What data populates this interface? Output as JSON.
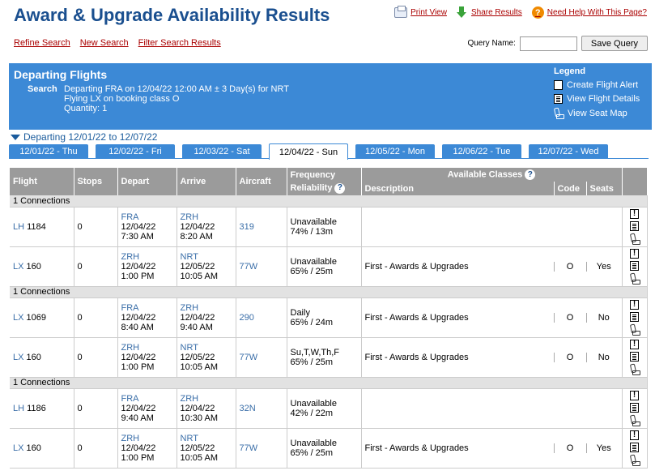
{
  "page": {
    "title": "Award & Upgrade Availability Results",
    "print_view": "Print View",
    "share_results": "Share Results",
    "need_help": "Need Help With This Page?",
    "refine_search": "Refine Search",
    "new_search": "New Search",
    "filter_results": "Filter Search Results",
    "query_name_label": "Query Name:",
    "query_name_value": "",
    "save_query": "Save Query"
  },
  "departing": {
    "header": "Departing Flights",
    "search_label": "Search",
    "search_line1": "Departing FRA on 12/04/22 12:00 AM ± 3 Day(s) for NRT",
    "search_line2": "Flying LX on booking class O",
    "search_line3": "Quantity: 1",
    "range": "Departing 12/01/22 to 12/07/22"
  },
  "legend": {
    "title": "Legend",
    "alert": "Create Flight Alert",
    "details": "View Flight Details",
    "seatmap": "View Seat Map"
  },
  "tabs": [
    "12/01/22 - Thu",
    "12/02/22 - Fri",
    "12/03/22 - Sat",
    "12/04/22 - Sun",
    "12/05/22 - Mon",
    "12/06/22 - Tue",
    "12/07/22 - Wed"
  ],
  "active_tab": "12/04/22 - Sun",
  "table": {
    "headers": {
      "flight": "Flight",
      "stops": "Stops",
      "depart": "Depart",
      "arrive": "Arrive",
      "aircraft": "Aircraft",
      "frequency": "Frequency",
      "reliability": "Reliability",
      "available_classes": "Available Classes",
      "description": "Description",
      "code": "Code",
      "seats": "Seats"
    },
    "groups": [
      {
        "label": "1 Connections",
        "flights": [
          {
            "airline": "LH",
            "number": "1184",
            "stops": "0",
            "dep_code": "FRA",
            "dep_date": "12/04/22",
            "dep_time": "7:30 AM",
            "arr_code": "ZRH",
            "arr_date": "12/04/22",
            "arr_time": "8:20 AM",
            "aircraft": "319",
            "frequency": "Unavailable",
            "reliability": "74% / 13m",
            "description": "",
            "code": "",
            "seats": ""
          },
          {
            "airline": "LX",
            "number": "160",
            "stops": "0",
            "dep_code": "ZRH",
            "dep_date": "12/04/22",
            "dep_time": "1:00 PM",
            "arr_code": "NRT",
            "arr_date": "12/05/22",
            "arr_time": "10:05 AM",
            "aircraft": "77W",
            "frequency": "Unavailable",
            "reliability": "65% / 25m",
            "description": "First - Awards & Upgrades",
            "code": "O",
            "seats": "Yes"
          }
        ]
      },
      {
        "label": "1 Connections",
        "flights": [
          {
            "airline": "LX",
            "number": "1069",
            "stops": "0",
            "dep_code": "FRA",
            "dep_date": "12/04/22",
            "dep_time": "8:40 AM",
            "arr_code": "ZRH",
            "arr_date": "12/04/22",
            "arr_time": "9:40 AM",
            "aircraft": "290",
            "frequency": "Daily",
            "reliability": "65% / 24m",
            "description": "First - Awards & Upgrades",
            "code": "O",
            "seats": "No"
          },
          {
            "airline": "LX",
            "number": "160",
            "stops": "0",
            "dep_code": "ZRH",
            "dep_date": "12/04/22",
            "dep_time": "1:00 PM",
            "arr_code": "NRT",
            "arr_date": "12/05/22",
            "arr_time": "10:05 AM",
            "aircraft": "77W",
            "frequency": "Su,T,W,Th,F",
            "reliability": "65% / 25m",
            "description": "First - Awards & Upgrades",
            "code": "O",
            "seats": "No"
          }
        ]
      },
      {
        "label": "1 Connections",
        "flights": [
          {
            "airline": "LH",
            "number": "1186",
            "stops": "0",
            "dep_code": "FRA",
            "dep_date": "12/04/22",
            "dep_time": "9:40 AM",
            "arr_code": "ZRH",
            "arr_date": "12/04/22",
            "arr_time": "10:30 AM",
            "aircraft": "32N",
            "frequency": "Unavailable",
            "reliability": "42% / 22m",
            "description": "",
            "code": "",
            "seats": ""
          },
          {
            "airline": "LX",
            "number": "160",
            "stops": "0",
            "dep_code": "ZRH",
            "dep_date": "12/04/22",
            "dep_time": "1:00 PM",
            "arr_code": "NRT",
            "arr_date": "12/05/22",
            "arr_time": "10:05 AM",
            "aircraft": "77W",
            "frequency": "Unavailable",
            "reliability": "65% / 25m",
            "description": "First - Awards & Upgrades",
            "code": "O",
            "seats": "Yes"
          }
        ]
      }
    ]
  }
}
